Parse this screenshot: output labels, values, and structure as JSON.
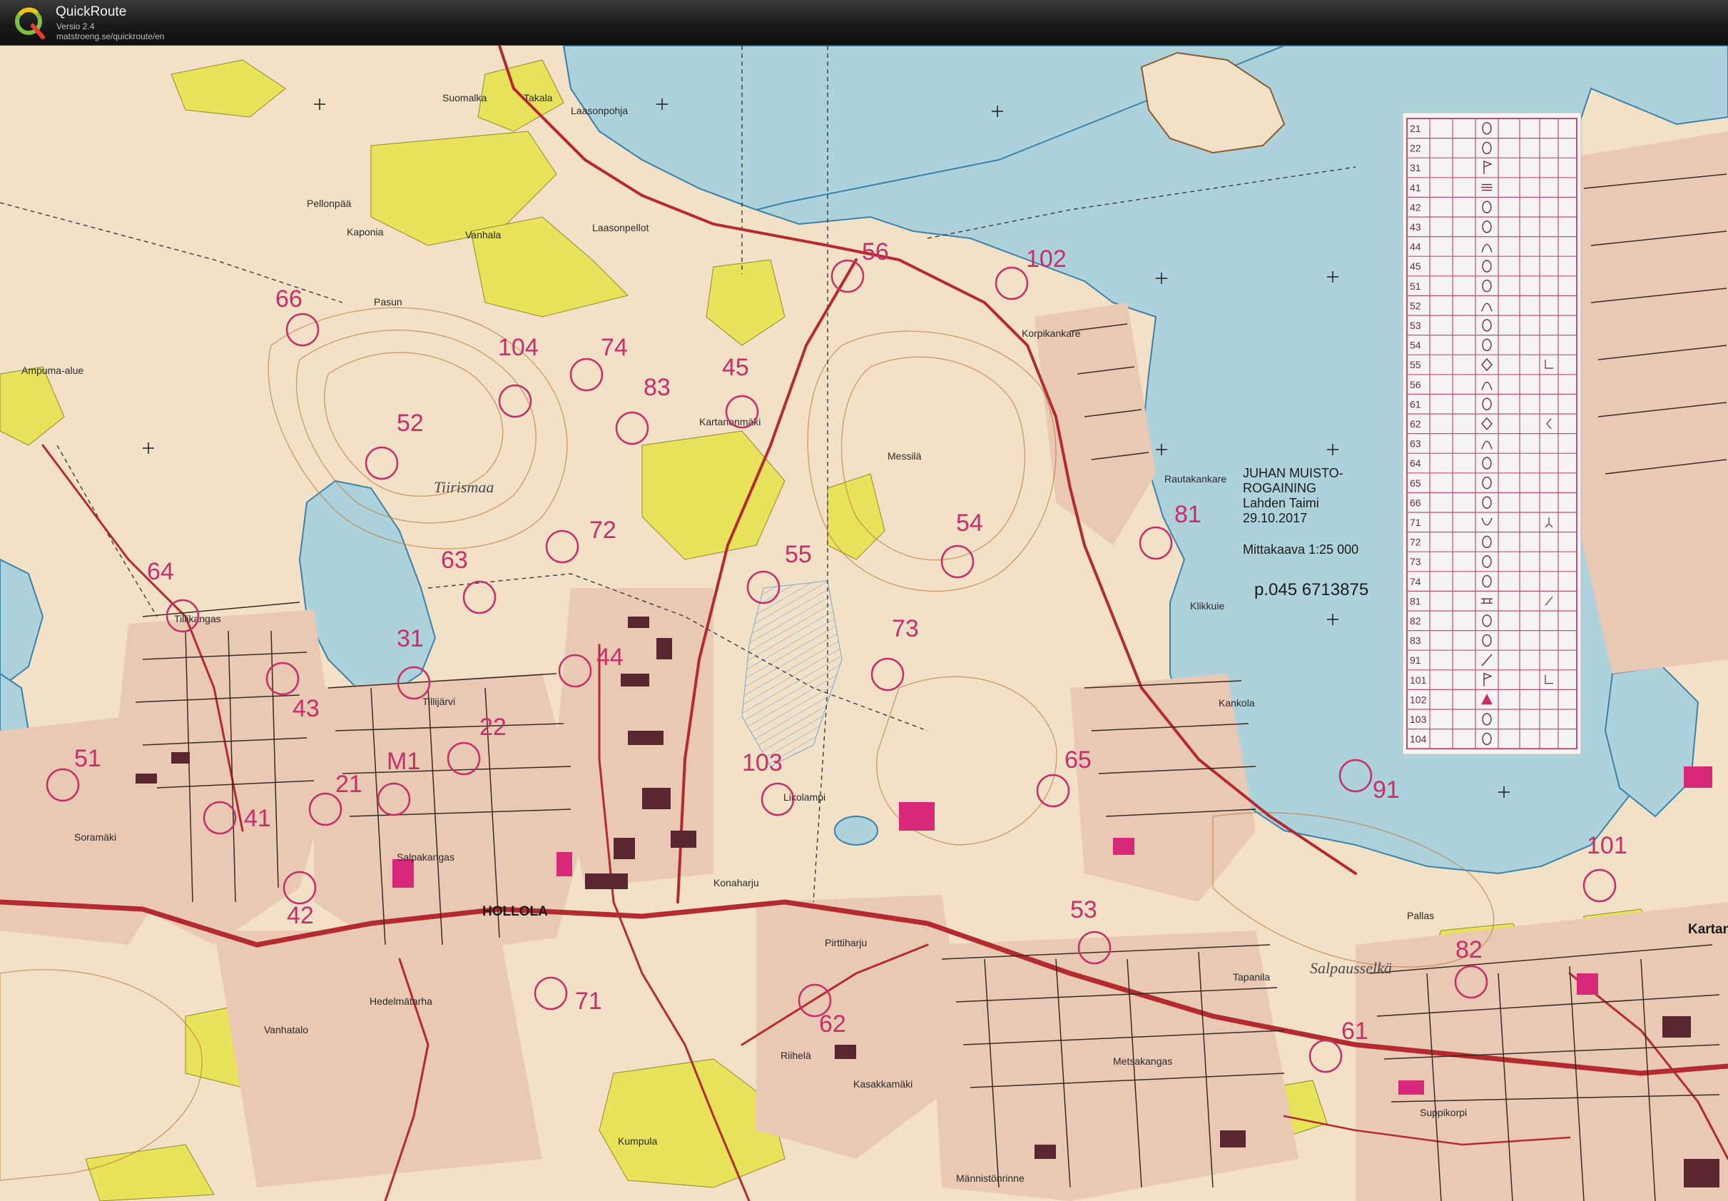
{
  "app": {
    "name": "QuickRoute",
    "version": "Versio 2.4",
    "url": "matstroeng.se/quickroute/en",
    "logo_icon": "quickroute-q-logo"
  },
  "colors": {
    "control": "#c5306b",
    "water": "#aed2dc",
    "land": "#f3e1c7",
    "field": "#e8e35a",
    "road": "#b32a2f",
    "building": "#5a2630",
    "builtup": "#e9c9b4"
  },
  "map": {
    "info": {
      "title_line1": "JUHAN MUISTO-",
      "title_line2": "ROGAINING",
      "organizer": "Lahden Taimi",
      "date": "29.10.2017",
      "scale": "Mittakaava 1:25 000",
      "phone": "p.045 6713875"
    },
    "places": [
      {
        "name": "Laasonpohja"
      },
      {
        "name": "Laasonpellot"
      },
      {
        "name": "Suomalka"
      },
      {
        "name": "Takala"
      },
      {
        "name": "Pellonpää"
      },
      {
        "name": "Kaponia"
      },
      {
        "name": "Vanhala"
      },
      {
        "name": "Pasun"
      },
      {
        "name": "Ampuma-alue"
      },
      {
        "name": "Tiirismaa"
      },
      {
        "name": "Kartanonmäki"
      },
      {
        "name": "Messilä"
      },
      {
        "name": "Korpikankare"
      },
      {
        "name": "Rautakankare"
      },
      {
        "name": "Klikkuie"
      },
      {
        "name": "Kankola"
      },
      {
        "name": "Tillikangas"
      },
      {
        "name": "Tillijärvi"
      },
      {
        "name": "Soramäki"
      },
      {
        "name": "Salpakangas"
      },
      {
        "name": "HOLLOLA"
      },
      {
        "name": "Pirttiharju"
      },
      {
        "name": "Riihelä"
      },
      {
        "name": "Kumpula"
      },
      {
        "name": "Vanhatalo"
      },
      {
        "name": "Hedelmätarha"
      },
      {
        "name": "Metsakangas"
      },
      {
        "name": "Tapanila"
      },
      {
        "name": "Salpausselkä"
      },
      {
        "name": "Pallas"
      },
      {
        "name": "Kartano"
      },
      {
        "name": "Likolampi"
      },
      {
        "name": "Kasakkamäki"
      },
      {
        "name": "Konaharju"
      },
      {
        "name": "Männistönrinne"
      },
      {
        "name": "Suppikorpi"
      }
    ],
    "controls": [
      {
        "id": "56"
      },
      {
        "id": "102"
      },
      {
        "id": "66"
      },
      {
        "id": "104"
      },
      {
        "id": "74"
      },
      {
        "id": "45"
      },
      {
        "id": "83"
      },
      {
        "id": "52"
      },
      {
        "id": "72"
      },
      {
        "id": "63"
      },
      {
        "id": "54"
      },
      {
        "id": "81"
      },
      {
        "id": "55"
      },
      {
        "id": "64"
      },
      {
        "id": "73"
      },
      {
        "id": "31"
      },
      {
        "id": "44"
      },
      {
        "id": "43"
      },
      {
        "id": "22"
      },
      {
        "id": "51"
      },
      {
        "id": "M1"
      },
      {
        "id": "21"
      },
      {
        "id": "41"
      },
      {
        "id": "103"
      },
      {
        "id": "65"
      },
      {
        "id": "91"
      },
      {
        "id": "101"
      },
      {
        "id": "42"
      },
      {
        "id": "53"
      },
      {
        "id": "82"
      },
      {
        "id": "71"
      },
      {
        "id": "62"
      },
      {
        "id": "61"
      }
    ],
    "description_table": {
      "rows": [
        {
          "code": "21",
          "symbol": "ellipse",
          "extra": ""
        },
        {
          "code": "22",
          "symbol": "ellipse",
          "extra": ""
        },
        {
          "code": "31",
          "symbol": "flag",
          "extra": ""
        },
        {
          "code": "41",
          "symbol": "striped-circle",
          "extra": ""
        },
        {
          "code": "42",
          "symbol": "ellipse",
          "extra": ""
        },
        {
          "code": "43",
          "symbol": "ellipse",
          "extra": ""
        },
        {
          "code": "44",
          "symbol": "bell",
          "extra": ""
        },
        {
          "code": "45",
          "symbol": "ellipse",
          "extra": ""
        },
        {
          "code": "51",
          "symbol": "ellipse",
          "extra": ""
        },
        {
          "code": "52",
          "symbol": "bell",
          "extra": ""
        },
        {
          "code": "53",
          "symbol": "ellipse",
          "extra": ""
        },
        {
          "code": "54",
          "symbol": "ellipse",
          "extra": ""
        },
        {
          "code": "55",
          "symbol": "diamond",
          "extra": "corner"
        },
        {
          "code": "56",
          "symbol": "bell",
          "extra": ""
        },
        {
          "code": "61",
          "symbol": "ellipse",
          "extra": ""
        },
        {
          "code": "62",
          "symbol": "diamond",
          "extra": "hook"
        },
        {
          "code": "63",
          "symbol": "bell",
          "extra": ""
        },
        {
          "code": "64",
          "symbol": "ellipse",
          "extra": ""
        },
        {
          "code": "65",
          "symbol": "ellipse",
          "extra": ""
        },
        {
          "code": "66",
          "symbol": "ellipse",
          "extra": ""
        },
        {
          "code": "71",
          "symbol": "cup",
          "extra": "fork"
        },
        {
          "code": "72",
          "symbol": "ellipse",
          "extra": ""
        },
        {
          "code": "73",
          "symbol": "ellipse",
          "extra": ""
        },
        {
          "code": "74",
          "symbol": "ellipse",
          "extra": ""
        },
        {
          "code": "81",
          "symbol": "ladder",
          "extra": "slash"
        },
        {
          "code": "82",
          "symbol": "ellipse",
          "extra": ""
        },
        {
          "code": "83",
          "symbol": "ellipse",
          "extra": ""
        },
        {
          "code": "91",
          "symbol": "slash",
          "extra": ""
        },
        {
          "code": "101",
          "symbol": "flag",
          "extra": "corner"
        },
        {
          "code": "102",
          "symbol": "triangle",
          "extra": ""
        },
        {
          "code": "103",
          "symbol": "ellipse",
          "extra": ""
        },
        {
          "code": "104",
          "symbol": "ellipse",
          "extra": ""
        }
      ]
    }
  }
}
